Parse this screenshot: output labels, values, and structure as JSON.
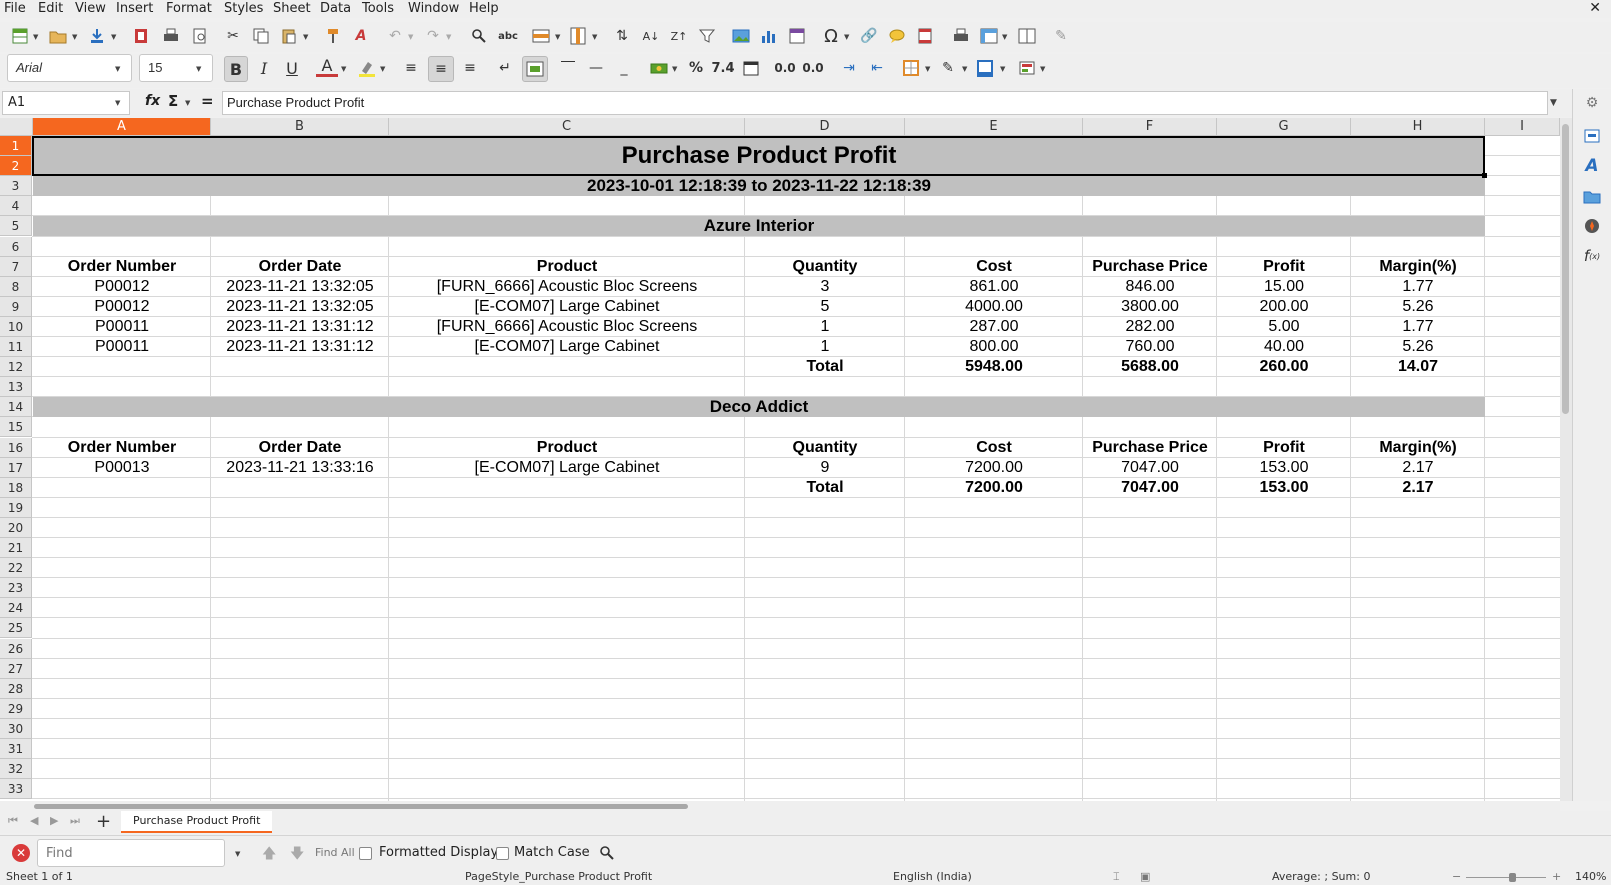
{
  "menu": [
    "File",
    "Edit",
    "View",
    "Insert",
    "Format",
    "Styles",
    "Sheet",
    "Data",
    "Tools",
    "Window",
    "Help"
  ],
  "font": {
    "name": "Arial",
    "size": "15"
  },
  "formula": {
    "cell_ref": "A1",
    "content": "Purchase Product Profit",
    "fx": "fx",
    "sigma": "Σ",
    "equals": "="
  },
  "columns": [
    "A",
    "B",
    "C",
    "D",
    "E",
    "F",
    "G",
    "H",
    "I"
  ],
  "rows": [
    "1",
    "2",
    "3",
    "4",
    "5",
    "6",
    "7",
    "8",
    "9",
    "10",
    "11",
    "12",
    "13",
    "14",
    "15",
    "16",
    "17",
    "18",
    "19",
    "20",
    "21",
    "22",
    "23",
    "24",
    "25",
    "26",
    "27",
    "28",
    "29",
    "30",
    "31",
    "32",
    "33"
  ],
  "report": {
    "title": "Purchase Product Profit",
    "period": "2023-10-01 12:18:39 to 2023-11-22 12:18:39",
    "headers": [
      "Order Number",
      "Order Date",
      "Product",
      "Quantity",
      "Cost",
      "Purchase Price",
      "Profit",
      "Margin(%)"
    ],
    "groups": [
      {
        "vendor": "Azure Interior",
        "rows": [
          [
            "P00012",
            "2023-11-21 13:32:05",
            "[FURN_6666] Acoustic Bloc Screens",
            "3",
            "861.00",
            "846.00",
            "15.00",
            "1.77"
          ],
          [
            "P00012",
            "2023-11-21 13:32:05",
            "[E-COM07] Large Cabinet",
            "5",
            "4000.00",
            "3800.00",
            "200.00",
            "5.26"
          ],
          [
            "P00011",
            "2023-11-21 13:31:12",
            "[FURN_6666] Acoustic Bloc Screens",
            "1",
            "287.00",
            "282.00",
            "5.00",
            "1.77"
          ],
          [
            "P00011",
            "2023-11-21 13:31:12",
            "[E-COM07] Large Cabinet",
            "1",
            "800.00",
            "760.00",
            "40.00",
            "5.26"
          ]
        ],
        "total": {
          "label": "Total",
          "cost": "5948.00",
          "purchase": "5688.00",
          "profit": "260.00",
          "margin": "14.07"
        }
      },
      {
        "vendor": "Deco Addict",
        "rows": [
          [
            "P00013",
            "2023-11-21 13:33:16",
            "[E-COM07] Large Cabinet",
            "9",
            "7200.00",
            "7047.00",
            "153.00",
            "2.17"
          ]
        ],
        "total": {
          "label": "Total",
          "cost": "7200.00",
          "purchase": "7047.00",
          "profit": "153.00",
          "margin": "2.17"
        }
      }
    ]
  },
  "sheet_tab": "Purchase Product Profit",
  "find": {
    "placeholder": "Find",
    "find_all": "Find All",
    "formatted_display": "Formatted Display",
    "match_case": "Match Case"
  },
  "status": {
    "sheet": "Sheet 1 of 1",
    "page_style": "PageStyle_Purchase Product Profit",
    "language": "English (India)",
    "summary": "Average: ; Sum: 0",
    "zoom": "140%"
  },
  "colors": {
    "selection": "#f5671f",
    "band": "#c0c0c0"
  }
}
